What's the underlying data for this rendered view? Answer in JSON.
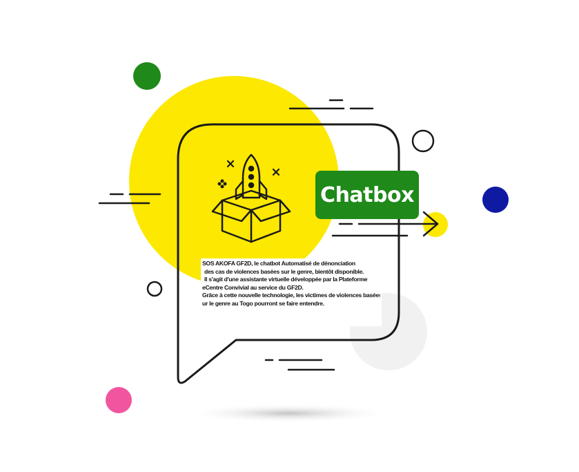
{
  "button": {
    "label": "Chatbox"
  },
  "description": {
    "lines": [
      "SOS AKOFA GF2D, le chatbot Automatisé de dénonciation",
      "des cas de violences basées sur le genre, bientôt disponible.",
      "Il s'agit d'une assistante virtuelle développée par la Plateforme",
      "eCentre Convivial au service du GF2D.",
      "Grâce à cette nouvelle technologie, les victimes de violences basées",
      "ur le genre au Togo pourront se faire entendre."
    ]
  },
  "colors": {
    "yellow": "#fce800",
    "green": "#1f8a1a",
    "navy": "#0f1aa3",
    "pink": "#f255a0",
    "light_gray": "#f2f2f2",
    "outline": "#1a1a1a"
  },
  "icons": [
    "rocket-icon",
    "open-box-icon",
    "sparkle-icon",
    "arrow-right-icon"
  ]
}
